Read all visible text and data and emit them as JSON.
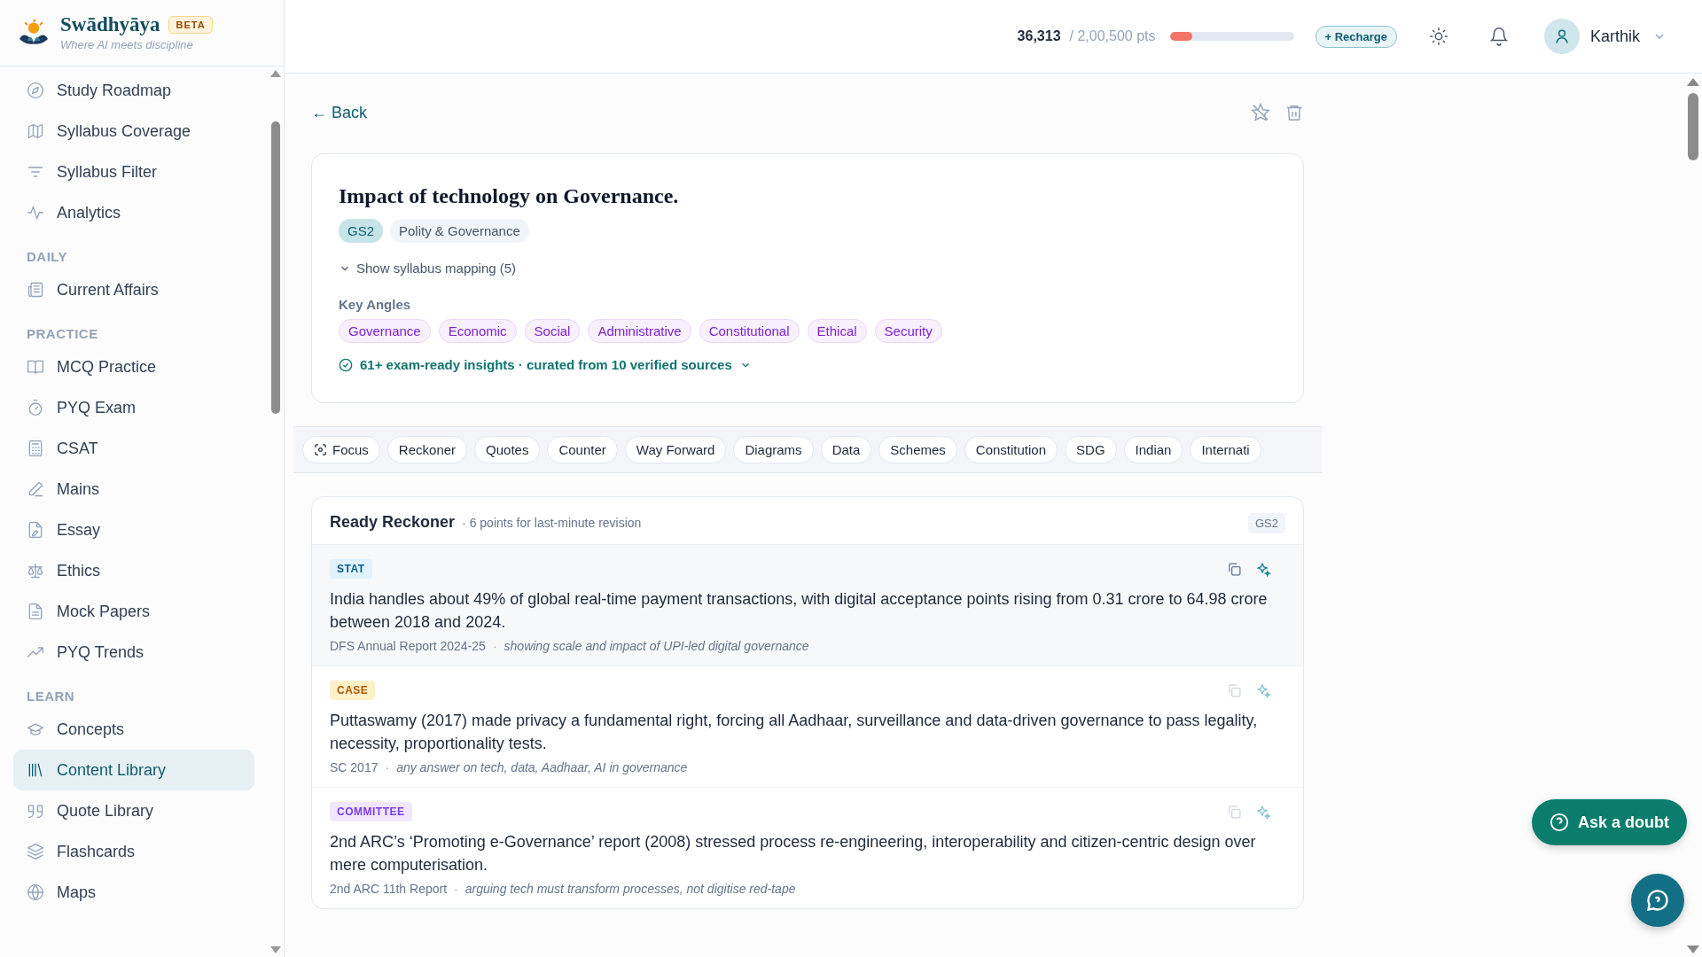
{
  "brand": {
    "name": "Swādhyāya",
    "badge": "BETA",
    "tagline": "Where AI meets discipline"
  },
  "sidebar": {
    "groups": [
      {
        "items": [
          {
            "label": "Study Roadmap",
            "selected": false
          },
          {
            "label": "Syllabus Coverage",
            "selected": false
          },
          {
            "label": "Syllabus Filter",
            "selected": false
          },
          {
            "label": "Analytics",
            "selected": false
          }
        ]
      },
      {
        "heading": "DAILY",
        "items": [
          {
            "label": "Current Affairs",
            "selected": false
          }
        ]
      },
      {
        "heading": "PRACTICE",
        "items": [
          {
            "label": "MCQ Practice",
            "selected": false
          },
          {
            "label": "PYQ Exam",
            "selected": false
          },
          {
            "label": "CSAT",
            "selected": false
          },
          {
            "label": "Mains",
            "selected": false
          },
          {
            "label": "Essay",
            "selected": false
          },
          {
            "label": "Ethics",
            "selected": false
          },
          {
            "label": "Mock Papers",
            "selected": false
          },
          {
            "label": "PYQ Trends",
            "selected": false
          }
        ]
      },
      {
        "heading": "LEARN",
        "items": [
          {
            "label": "Concepts",
            "selected": false
          },
          {
            "label": "Content Library",
            "selected": true
          },
          {
            "label": "Quote Library",
            "selected": false
          },
          {
            "label": "Flashcards",
            "selected": false
          },
          {
            "label": "Maps",
            "selected": false
          }
        ]
      }
    ]
  },
  "header": {
    "points": "36,313",
    "points_total": "/ 2,00,500 pts",
    "level": 0.18,
    "recharge": "+ Recharge",
    "user": "Karthik"
  },
  "back": "← Back",
  "topic": {
    "title": "Impact of technology on Governance.",
    "tags": [
      {
        "label": "GS2",
        "kind": "paper"
      },
      {
        "label": "Polity & Governance",
        "kind": "subject"
      }
    ],
    "mapping": {
      "label": "Show syllabus mapping (5)",
      "expanded": false
    },
    "angles_heading": "Key Angles",
    "angles": [
      "Governance",
      "Economic",
      "Social",
      "Administrative",
      "Constitutional",
      "Ethical",
      "Security"
    ],
    "insights": "61+ exam-ready insights · curated from 10 verified sources"
  },
  "tabs": [
    {
      "label": "Focus",
      "kind": "focus"
    },
    {
      "label": "Reckoner",
      "kind": "section"
    },
    {
      "label": "Quotes",
      "kind": "section"
    },
    {
      "label": "Counter",
      "kind": "section"
    },
    {
      "label": "Way Forward",
      "kind": "section"
    },
    {
      "label": "Diagrams",
      "kind": "section"
    },
    {
      "label": "Data",
      "kind": "section"
    },
    {
      "label": "Schemes",
      "kind": "section"
    },
    {
      "label": "Constitution",
      "kind": "section"
    },
    {
      "label": "SDG",
      "kind": "section"
    },
    {
      "label": "Indian",
      "kind": "section"
    },
    {
      "label": "Internati",
      "kind": "section"
    }
  ],
  "reckoner": {
    "title": "Ready Reckoner",
    "subtitle": "· 6 points for last-minute revision",
    "badge": "GS2",
    "points": [
      {
        "kind": "stat",
        "badge": "STAT",
        "highlighted": true,
        "text": "India handles about 49% of global real-time payment transactions, with digital acceptance points rising from 0.31 crore to 64.98 crore between 2018 and 2024.",
        "source": "DFS Annual Report 2024-25",
        "separator": "·",
        "use": "showing scale and impact of UPI-led digital governance"
      },
      {
        "kind": "case",
        "badge": "CASE",
        "highlighted": false,
        "text": "Puttaswamy (2017) made privacy a fundamental right, forcing all Aadhaar, surveillance and data-driven governance to pass legality, necessity, proportionality tests.",
        "source": "SC 2017",
        "separator": "·",
        "use": "any answer on tech, data, Aadhaar, AI in governance"
      },
      {
        "kind": "committee",
        "badge": "COMMITTEE",
        "highlighted": false,
        "text": "2nd ARC’s ‘Promoting e-Governance’ report (2008) stressed process re-engineering, interoperability and citizen-centric design over mere computerisation.",
        "source": "2nd ARC 11th Report",
        "separator": "·",
        "use": "arguing tech must transform processes, not digitise red-tape"
      }
    ]
  },
  "ask_button": "Ask a doubt"
}
